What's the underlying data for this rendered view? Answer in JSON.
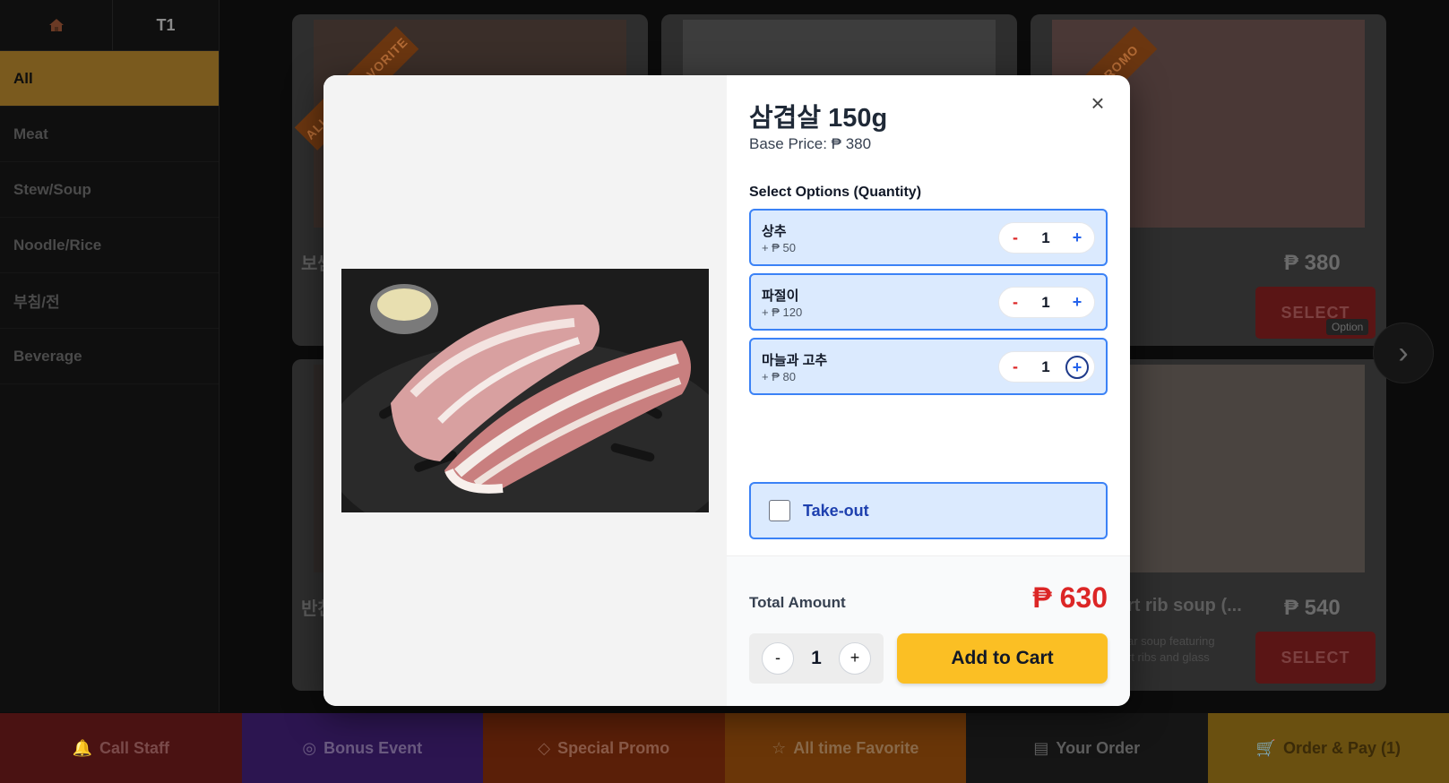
{
  "sidebar": {
    "table_label": "T1",
    "categories": [
      {
        "label": "All"
      },
      {
        "label": "Meat"
      },
      {
        "label": "Stew/Soup"
      },
      {
        "label": "Noodle/Rice"
      },
      {
        "label": "부침/전"
      },
      {
        "label": "Beverage"
      }
    ]
  },
  "background_cards": {
    "card1": {
      "ribbon": "ALL TIME FAVORITE",
      "name_fragment": "보쌈"
    },
    "card3": {
      "ribbon": "SPECIAL PROMO",
      "price": "₱ 380",
      "select": "SELECT",
      "option_badge": "Option"
    },
    "card4": {
      "name_fragment": "반찬"
    },
    "card6": {
      "name_fragment": "rt rib soup (...",
      "desc_line1": "ar soup featuring",
      "desc_line2": "rt ribs and glass",
      "price": "₱ 540",
      "select": "SELECT"
    }
  },
  "modal": {
    "title": "삼겹살 150g",
    "base_price": "Base Price: ₱ 380",
    "options_heading": "Select Options (Quantity)",
    "options": [
      {
        "name": "상추",
        "price": "+ ₱ 50",
        "qty": "1"
      },
      {
        "name": "파절이",
        "price": "+ ₱ 120",
        "qty": "1"
      },
      {
        "name": "마늘과 고추",
        "price": "+ ₱ 80",
        "qty": "1"
      }
    ],
    "takeout_label": "Take-out",
    "takeout_checked": false,
    "total_label": "Total Amount",
    "total_value": "₱ 630",
    "quantity": "1",
    "add_to_cart": "Add to Cart",
    "close": "×",
    "minus": "-",
    "plus": "+"
  },
  "bottom_bar": {
    "call_staff": "Call Staff",
    "bonus_event": "Bonus Event",
    "special_promo": "Special Promo",
    "all_time_favorite": "All time Favorite",
    "your_order": "Your Order",
    "order_pay": "Order & Pay (1)"
  },
  "colors": {
    "accent": "#fbbf24",
    "price_red": "#dc2626",
    "option_bg": "#dbeafe",
    "option_border": "#3b82f6"
  }
}
